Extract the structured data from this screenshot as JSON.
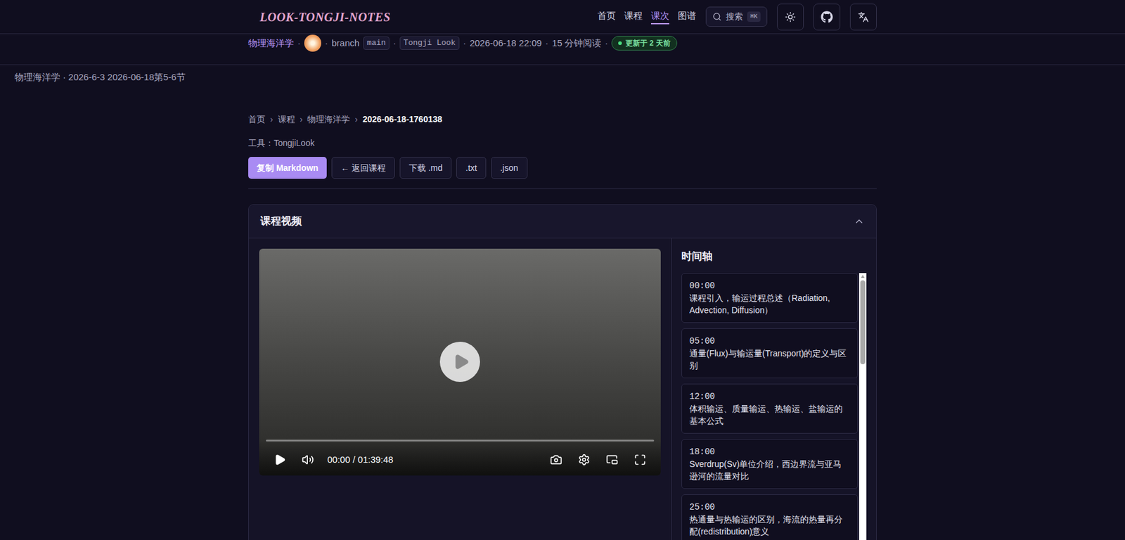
{
  "nav": {
    "logo": "LOOK-TONGJI-NOTES",
    "links": [
      {
        "label": "首页",
        "selected": false
      },
      {
        "label": "课程",
        "selected": false
      },
      {
        "label": "课次",
        "selected": true
      },
      {
        "label": "图谱",
        "selected": false
      }
    ],
    "search": {
      "placeholder": "搜索",
      "shortcut": "⌘K"
    }
  },
  "meta": {
    "separator": "·",
    "course": "物理海洋学",
    "branch_label": "branch",
    "branch": "main",
    "tool_tag": "Tongji Look",
    "datetime": "2026-06-18 22:09",
    "read_time": "15 分钟阅读",
    "badge": "更新于 2 天前"
  },
  "page_title": "物理海洋学 · 2026-6-3 2026-06-18第5-6节",
  "breadcrumb": {
    "separator": "›",
    "items": [
      {
        "label": "首页",
        "current": false
      },
      {
        "label": "课程",
        "current": false
      },
      {
        "label": "物理海洋学",
        "current": false
      },
      {
        "label": "2026-06-18-1760138",
        "current": true
      }
    ]
  },
  "tool": "工具：TongjiLook",
  "actions": [
    {
      "label": "复制 Markdown",
      "primary": true
    },
    {
      "label": "← 返回课程",
      "primary": false
    },
    {
      "label": "下载 .md",
      "primary": false
    },
    {
      "label": ".txt",
      "primary": false
    },
    {
      "label": ".json",
      "primary": false
    }
  ],
  "video_card": {
    "title": "课程视频",
    "expanded": true,
    "player": {
      "time": "00:00 / 01:39:48",
      "playing": false,
      "progress": 0
    },
    "timeline": {
      "title": "时间轴",
      "items": [
        {
          "time": "00:00",
          "text": "课程引入，输运过程总述（Radiation, Advection, Diffusion）"
        },
        {
          "time": "05:00",
          "text": "通量(Flux)与输运量(Transport)的定义与区别"
        },
        {
          "time": "12:00",
          "text": "体积输运、质量输运、热输运、盐输运的基本公式"
        },
        {
          "time": "18:00",
          "text": "Sverdrup(Sv)单位介绍，西边界流与亚马逊河的流量对比"
        },
        {
          "time": "25:00",
          "text": "热通量与热输运的区别，海流的热量再分配(redistribution)意义"
        }
      ]
    }
  }
}
